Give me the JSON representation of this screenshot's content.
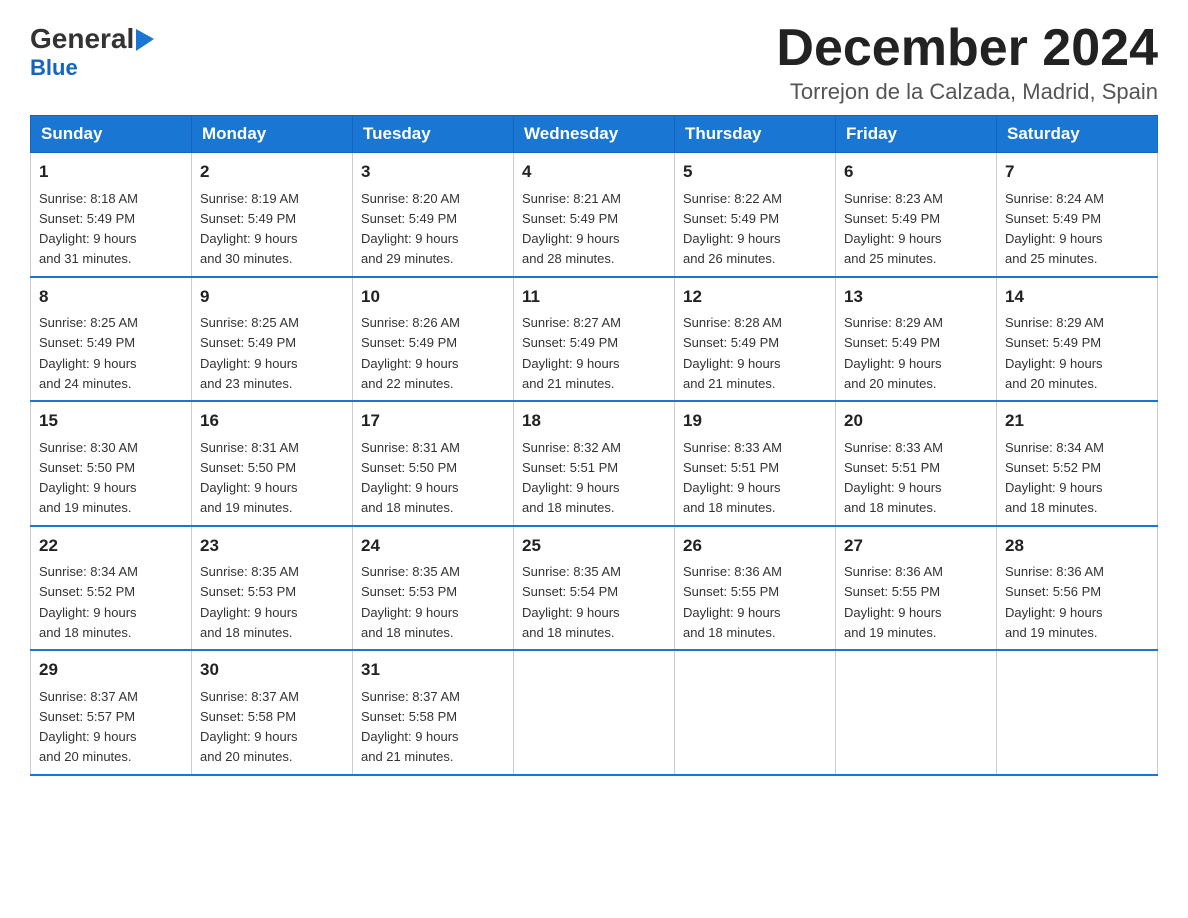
{
  "logo": {
    "general": "General",
    "arrow": "▶",
    "blue": "Blue"
  },
  "header": {
    "month": "December 2024",
    "location": "Torrejon de la Calzada, Madrid, Spain"
  },
  "weekdays": [
    "Sunday",
    "Monday",
    "Tuesday",
    "Wednesday",
    "Thursday",
    "Friday",
    "Saturday"
  ],
  "weeks": [
    [
      {
        "day": "1",
        "sunrise": "8:18 AM",
        "sunset": "5:49 PM",
        "daylight": "9 hours and 31 minutes."
      },
      {
        "day": "2",
        "sunrise": "8:19 AM",
        "sunset": "5:49 PM",
        "daylight": "9 hours and 30 minutes."
      },
      {
        "day": "3",
        "sunrise": "8:20 AM",
        "sunset": "5:49 PM",
        "daylight": "9 hours and 29 minutes."
      },
      {
        "day": "4",
        "sunrise": "8:21 AM",
        "sunset": "5:49 PM",
        "daylight": "9 hours and 28 minutes."
      },
      {
        "day": "5",
        "sunrise": "8:22 AM",
        "sunset": "5:49 PM",
        "daylight": "9 hours and 26 minutes."
      },
      {
        "day": "6",
        "sunrise": "8:23 AM",
        "sunset": "5:49 PM",
        "daylight": "9 hours and 25 minutes."
      },
      {
        "day": "7",
        "sunrise": "8:24 AM",
        "sunset": "5:49 PM",
        "daylight": "9 hours and 25 minutes."
      }
    ],
    [
      {
        "day": "8",
        "sunrise": "8:25 AM",
        "sunset": "5:49 PM",
        "daylight": "9 hours and 24 minutes."
      },
      {
        "day": "9",
        "sunrise": "8:25 AM",
        "sunset": "5:49 PM",
        "daylight": "9 hours and 23 minutes."
      },
      {
        "day": "10",
        "sunrise": "8:26 AM",
        "sunset": "5:49 PM",
        "daylight": "9 hours and 22 minutes."
      },
      {
        "day": "11",
        "sunrise": "8:27 AM",
        "sunset": "5:49 PM",
        "daylight": "9 hours and 21 minutes."
      },
      {
        "day": "12",
        "sunrise": "8:28 AM",
        "sunset": "5:49 PM",
        "daylight": "9 hours and 21 minutes."
      },
      {
        "day": "13",
        "sunrise": "8:29 AM",
        "sunset": "5:49 PM",
        "daylight": "9 hours and 20 minutes."
      },
      {
        "day": "14",
        "sunrise": "8:29 AM",
        "sunset": "5:49 PM",
        "daylight": "9 hours and 20 minutes."
      }
    ],
    [
      {
        "day": "15",
        "sunrise": "8:30 AM",
        "sunset": "5:50 PM",
        "daylight": "9 hours and 19 minutes."
      },
      {
        "day": "16",
        "sunrise": "8:31 AM",
        "sunset": "5:50 PM",
        "daylight": "9 hours and 19 minutes."
      },
      {
        "day": "17",
        "sunrise": "8:31 AM",
        "sunset": "5:50 PM",
        "daylight": "9 hours and 18 minutes."
      },
      {
        "day": "18",
        "sunrise": "8:32 AM",
        "sunset": "5:51 PM",
        "daylight": "9 hours and 18 minutes."
      },
      {
        "day": "19",
        "sunrise": "8:33 AM",
        "sunset": "5:51 PM",
        "daylight": "9 hours and 18 minutes."
      },
      {
        "day": "20",
        "sunrise": "8:33 AM",
        "sunset": "5:51 PM",
        "daylight": "9 hours and 18 minutes."
      },
      {
        "day": "21",
        "sunrise": "8:34 AM",
        "sunset": "5:52 PM",
        "daylight": "9 hours and 18 minutes."
      }
    ],
    [
      {
        "day": "22",
        "sunrise": "8:34 AM",
        "sunset": "5:52 PM",
        "daylight": "9 hours and 18 minutes."
      },
      {
        "day": "23",
        "sunrise": "8:35 AM",
        "sunset": "5:53 PM",
        "daylight": "9 hours and 18 minutes."
      },
      {
        "day": "24",
        "sunrise": "8:35 AM",
        "sunset": "5:53 PM",
        "daylight": "9 hours and 18 minutes."
      },
      {
        "day": "25",
        "sunrise": "8:35 AM",
        "sunset": "5:54 PM",
        "daylight": "9 hours and 18 minutes."
      },
      {
        "day": "26",
        "sunrise": "8:36 AM",
        "sunset": "5:55 PM",
        "daylight": "9 hours and 18 minutes."
      },
      {
        "day": "27",
        "sunrise": "8:36 AM",
        "sunset": "5:55 PM",
        "daylight": "9 hours and 19 minutes."
      },
      {
        "day": "28",
        "sunrise": "8:36 AM",
        "sunset": "5:56 PM",
        "daylight": "9 hours and 19 minutes."
      }
    ],
    [
      {
        "day": "29",
        "sunrise": "8:37 AM",
        "sunset": "5:57 PM",
        "daylight": "9 hours and 20 minutes."
      },
      {
        "day": "30",
        "sunrise": "8:37 AM",
        "sunset": "5:58 PM",
        "daylight": "9 hours and 20 minutes."
      },
      {
        "day": "31",
        "sunrise": "8:37 AM",
        "sunset": "5:58 PM",
        "daylight": "9 hours and 21 minutes."
      },
      null,
      null,
      null,
      null
    ]
  ],
  "labels": {
    "sunrise": "Sunrise:",
    "sunset": "Sunset:",
    "daylight": "Daylight:"
  }
}
